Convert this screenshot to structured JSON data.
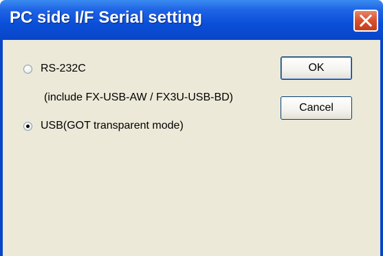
{
  "window": {
    "title": "PC side I/F  Serial setting",
    "close_icon": "close-icon"
  },
  "options": {
    "rs232c_label": "RS-232C",
    "rs232c_note": "(include FX-USB-AW / FX3U-USB-BD)",
    "usb_label": "USB(GOT transparent mode)",
    "selected": "usb"
  },
  "buttons": {
    "ok_label": "OK",
    "cancel_label": "Cancel"
  },
  "colors": {
    "titlebar": "#0a4fd8",
    "client_bg": "#ece9d8",
    "close_button": "#d7502e"
  }
}
